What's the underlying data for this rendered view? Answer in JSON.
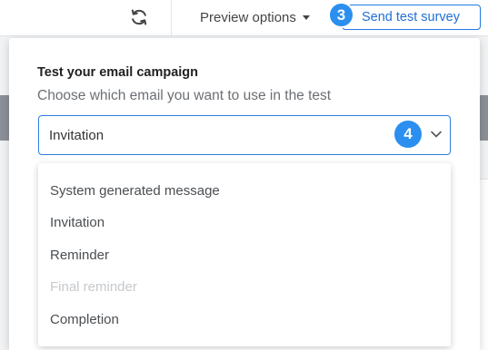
{
  "toolbar": {
    "refresh_icon": "refresh-icon",
    "preview_options_label": "Preview options",
    "caret_icon": "caret-down-icon",
    "send_test_label": "Send test survey",
    "step_badge_send": "3"
  },
  "panel": {
    "title": "Test your email campaign",
    "subtitle": "Choose which email you want to use in the test",
    "select": {
      "value": "Invitation",
      "step_badge": "4",
      "chevron_icon": "chevron-down-icon"
    }
  },
  "dropdown": {
    "options": [
      {
        "label": "System generated message",
        "disabled": false
      },
      {
        "label": "Invitation",
        "disabled": false
      },
      {
        "label": "Reminder",
        "disabled": false
      },
      {
        "label": "Final reminder",
        "disabled": true
      },
      {
        "label": "Completion",
        "disabled": false
      }
    ]
  },
  "colors": {
    "accent": "#1f7ae0",
    "badge": "#2b8ff0",
    "disabled_text": "#c6c9cc"
  }
}
